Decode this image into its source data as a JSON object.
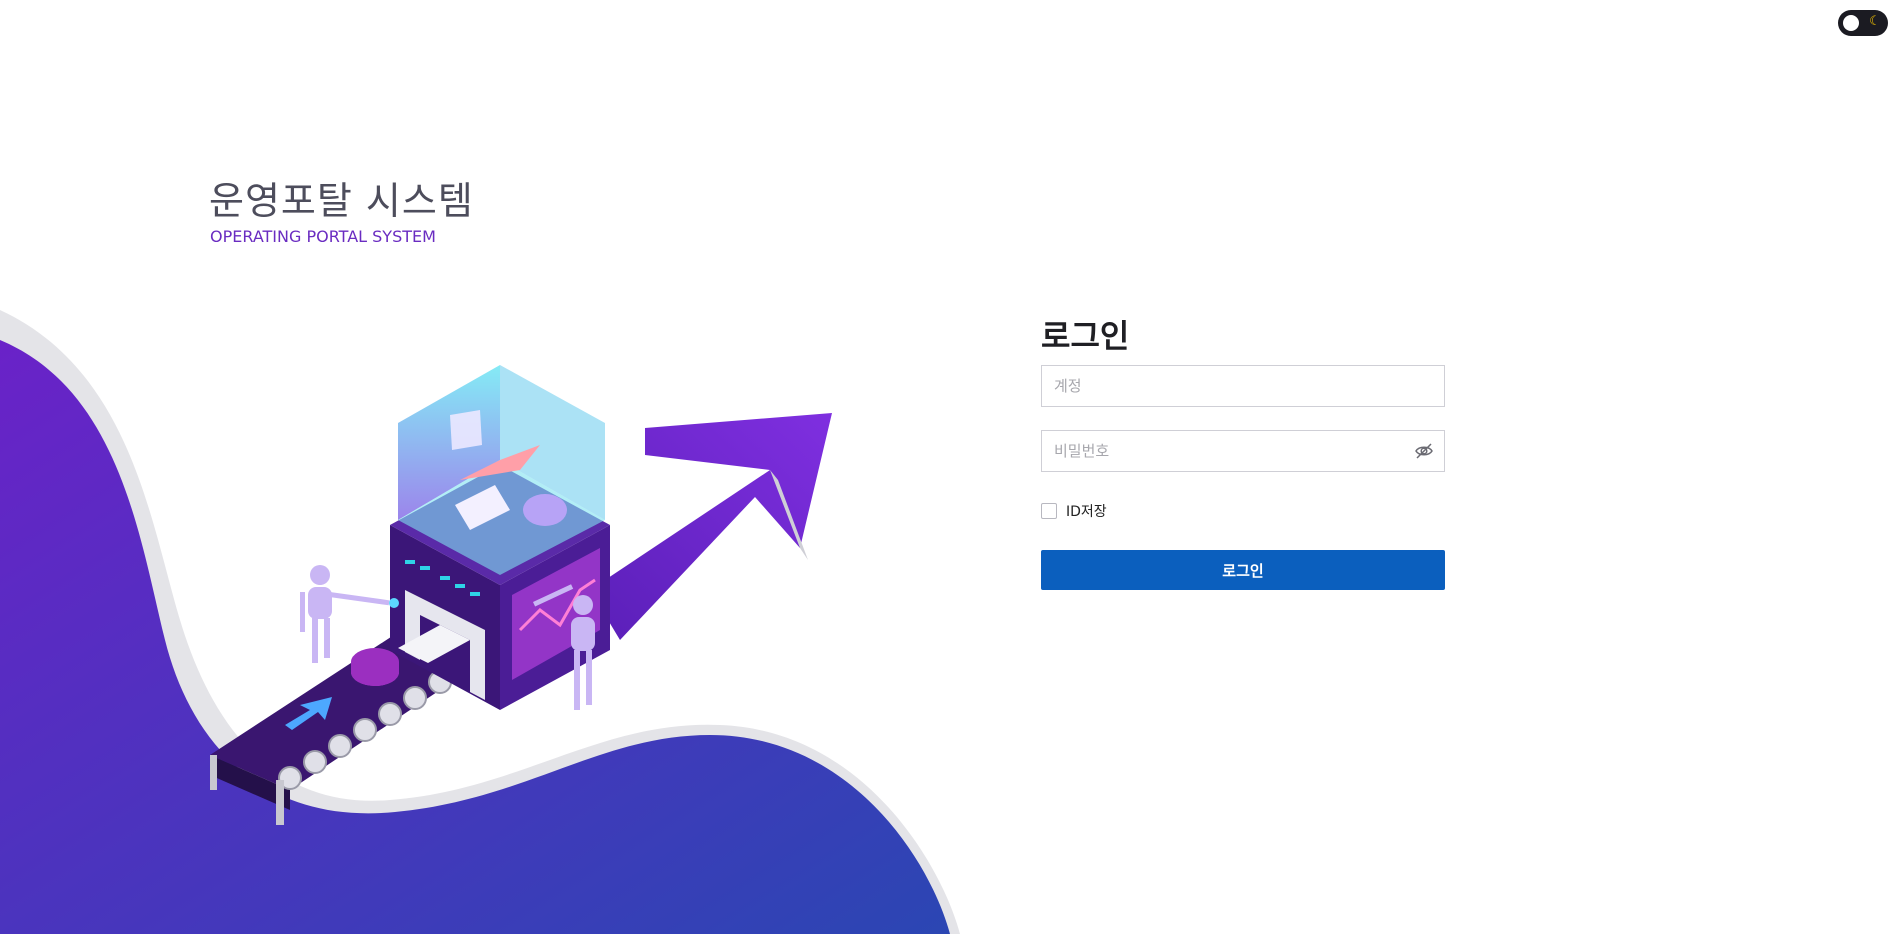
{
  "brand": {
    "title": "운영포탈 시스템",
    "subtitle": "OPERATING PORTAL SYSTEM"
  },
  "theme_toggle": {
    "icon": "moon-icon"
  },
  "login": {
    "heading": "로그인",
    "account_placeholder": "계정",
    "account_value": "",
    "password_placeholder": "비밀번호",
    "password_value": "",
    "password_visibility_icon": "eye-off-icon",
    "remember_label": "ID저장",
    "remember_checked": false,
    "submit_label": "로그인"
  },
  "colors": {
    "accent_purple": "#6a2cc1",
    "button_blue": "#0b5fbe",
    "wave_start": "#6a22c8",
    "wave_end": "#2b46b3"
  }
}
